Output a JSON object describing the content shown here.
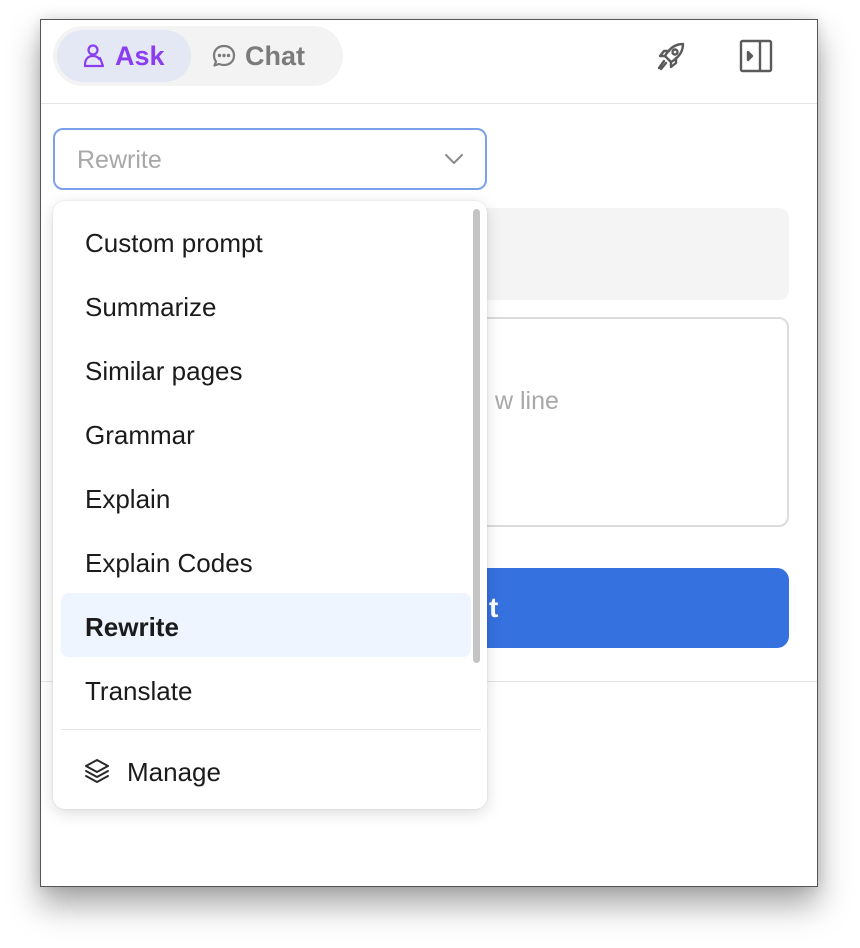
{
  "header": {
    "tabs": [
      {
        "label": "Ask",
        "icon": "ask-icon",
        "selected": true
      },
      {
        "label": "Chat",
        "icon": "chat-bubble-icon",
        "selected": false
      }
    ],
    "actions": [
      {
        "icon": "rocket-icon"
      },
      {
        "icon": "sidebar-toggle-icon"
      }
    ]
  },
  "prompt_select": {
    "value": "Rewrite"
  },
  "background": {
    "textarea_placeholder_fragment": "w line",
    "submit_fragment": "t"
  },
  "dropdown": {
    "items": [
      {
        "label": "Custom prompt"
      },
      {
        "label": "Summarize"
      },
      {
        "label": "Similar pages"
      },
      {
        "label": "Grammar"
      },
      {
        "label": "Explain"
      },
      {
        "label": "Explain Codes"
      },
      {
        "label": "Rewrite",
        "selected": true
      },
      {
        "label": "Translate"
      }
    ],
    "manage_label": "Manage",
    "manage_icon": "layers-icon"
  },
  "colors": {
    "accent_purple": "#8b3df0",
    "primary_blue": "#3671e0",
    "selected_item_bg": "#eef5fe",
    "focus_border": "#7ba1ea"
  }
}
